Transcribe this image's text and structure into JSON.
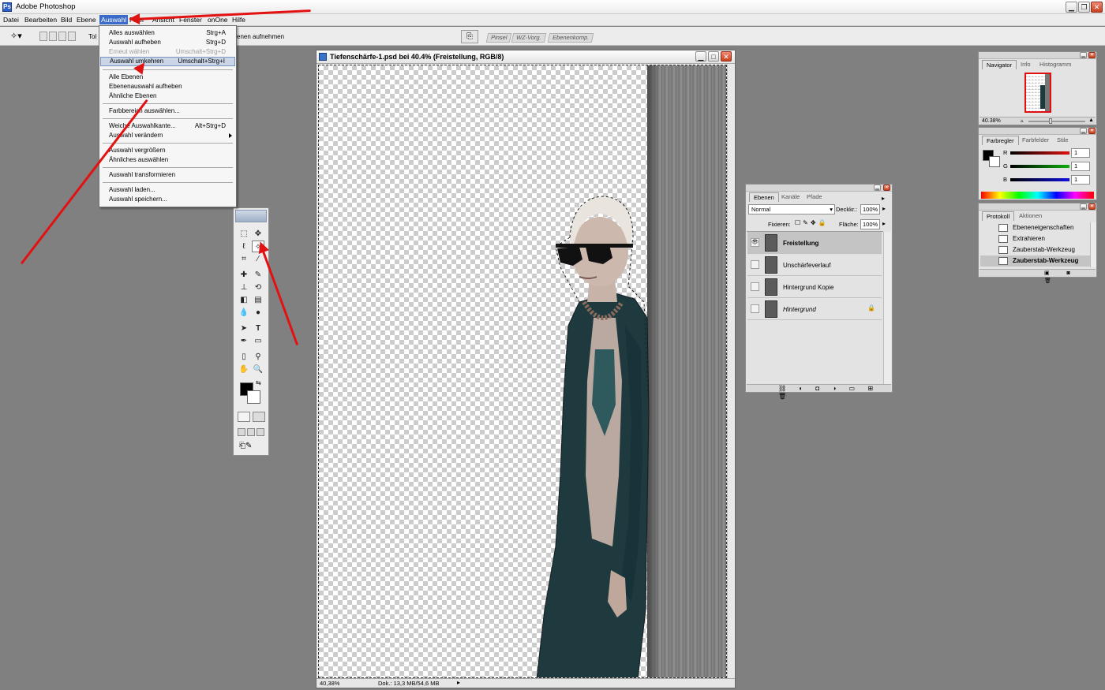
{
  "app": {
    "title": "Adobe Photoshop"
  },
  "menubar": {
    "items": [
      "Datei",
      "Bearbeiten",
      "Bild",
      "Ebene",
      "Auswahl",
      "Filter",
      "Ansicht",
      "Fenster",
      "onOne",
      "Hilfe"
    ],
    "active": "Auswahl"
  },
  "options": {
    "tolerance_label": "Tol",
    "contiguous_label": "enen aufnehmen"
  },
  "palette_well": {
    "tabs": [
      "Pinsel",
      "WZ-Vorg.",
      "Ebenenkomp."
    ]
  },
  "dropdown": {
    "items": [
      {
        "label": "Alles auswählen",
        "shortcut": "Strg+A"
      },
      {
        "label": "Auswahl aufheben",
        "shortcut": "Strg+D"
      },
      {
        "label": "Erneut wählen",
        "shortcut": "Umschalt+Strg+D"
      },
      {
        "label": "Auswahl umkehren",
        "shortcut": "Umschalt+Strg+I"
      },
      {
        "label": "Alle Ebenen",
        "shortcut": ""
      },
      {
        "label": "Ebenenauswahl aufheben",
        "shortcut": ""
      },
      {
        "label": "Ähnliche Ebenen",
        "shortcut": ""
      },
      {
        "label": "Farbbereich auswählen...",
        "shortcut": ""
      },
      {
        "label": "Weiche Auswahlkante...",
        "shortcut": "Alt+Strg+D"
      },
      {
        "label": "Auswahl verändern",
        "shortcut": ""
      },
      {
        "label": "Auswahl vergrößern",
        "shortcut": ""
      },
      {
        "label": "Ähnliches auswählen",
        "shortcut": ""
      },
      {
        "label": "Auswahl transformieren",
        "shortcut": ""
      },
      {
        "label": "Auswahl laden...",
        "shortcut": ""
      },
      {
        "label": "Auswahl speichern...",
        "shortcut": ""
      }
    ]
  },
  "document": {
    "title": "Tiefenschärfe-1.psd bei 40.4% (Freistellung, RGB/8)",
    "zoom": "40,38%",
    "doc_size": "Dok.: 13,3 MB/54,6 MB"
  },
  "navigator": {
    "tabs": [
      "Navigator",
      "Info",
      "Histogramm"
    ],
    "zoom": "40.38%"
  },
  "color": {
    "tabs": [
      "Farbregler",
      "Farbfelder",
      "Stile"
    ],
    "channels": [
      {
        "label": "R",
        "value": "1",
        "color": "#e01010"
      },
      {
        "label": "G",
        "value": "1",
        "color": "#10b010"
      },
      {
        "label": "B",
        "value": "1",
        "color": "#1010e0"
      }
    ]
  },
  "history": {
    "tabs": [
      "Protokoll",
      "Aktionen"
    ],
    "items": [
      "Ebeneneigenschaften",
      "Extrahieren",
      "Zauberstab-Werkzeug",
      "Zauberstab-Werkzeug"
    ]
  },
  "layers": {
    "tabs": [
      "Ebenen",
      "Kanäle",
      "Pfade"
    ],
    "blend_mode": "Normal",
    "opacity_label": "Deckkr.:",
    "opacity": "100%",
    "lock_label": "Fixieren:",
    "fill_label": "Fläche:",
    "fill": "100%",
    "items": [
      "Freistellung",
      "Unschärfeverlauf",
      "Hintergrund Kopie",
      "Hintergrund"
    ]
  },
  "annotations": {
    "arrow_color": "#e31212"
  }
}
